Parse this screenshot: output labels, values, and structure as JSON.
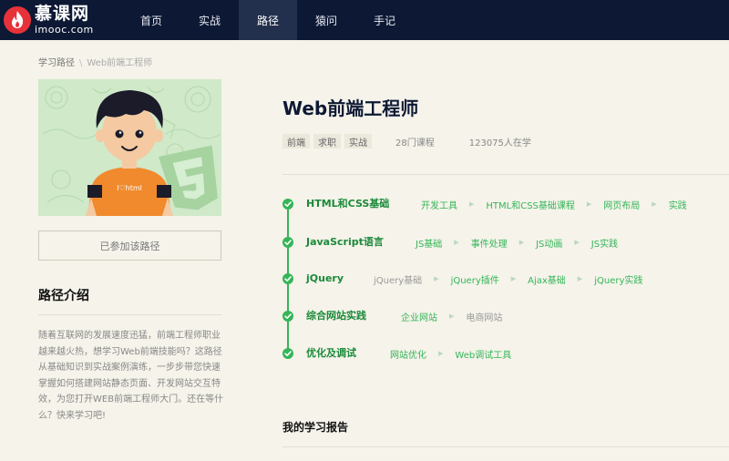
{
  "brand": {
    "name_cn": "慕课网",
    "name_en": "imooc.com"
  },
  "nav": [
    {
      "label": "首页",
      "active": false
    },
    {
      "label": "实战",
      "active": false
    },
    {
      "label": "路径",
      "active": true
    },
    {
      "label": "猿问",
      "active": false
    },
    {
      "label": "手记",
      "active": false
    }
  ],
  "breadcrumb": {
    "parent": "学习路径",
    "separator": "\\",
    "current": "Web前端工程师"
  },
  "banner": {
    "shirt_text": "I♡html"
  },
  "join_button": "已参加该路径",
  "intro": {
    "title": "路径介绍",
    "text": "随着互联网的发展速度迅猛，前端工程师职业越来越火热，想学习Web前端技能吗？这路径从基础知识到实战案例演练，一步步带您快速掌握如何搭建网站静态页面、开发网站交互特效，为您打开WEB前端工程师大门。还在等什么？快来学习吧!"
  },
  "path": {
    "title": "Web前端工程师",
    "tags": [
      "前端",
      "求职",
      "实战"
    ],
    "course_count": "28门课程",
    "learners": "123075人在学"
  },
  "stages": [
    {
      "name": "HTML和CSS基础",
      "courses": [
        {
          "label": "开发工具",
          "done": true
        },
        {
          "label": "HTML和CSS基础课程",
          "done": true
        },
        {
          "label": "网页布局",
          "done": true
        },
        {
          "label": "实践",
          "done": true
        }
      ]
    },
    {
      "name": "JavaScript语言",
      "courses": [
        {
          "label": "JS基础",
          "done": true
        },
        {
          "label": "事件处理",
          "done": true
        },
        {
          "label": "JS动画",
          "done": true
        },
        {
          "label": "JS实践",
          "done": true
        }
      ]
    },
    {
      "name": "jQuery",
      "courses": [
        {
          "label": "jQuery基础",
          "done": false
        },
        {
          "label": "jQuery插件",
          "done": true
        },
        {
          "label": "Ajax基础",
          "done": true
        },
        {
          "label": "jQuery实践",
          "done": true
        }
      ]
    },
    {
      "name": "综合网站实践",
      "courses": [
        {
          "label": "企业网站",
          "done": true
        },
        {
          "label": "电商网站",
          "done": false
        }
      ]
    },
    {
      "name": "优化及调试",
      "courses": [
        {
          "label": "网站优化",
          "done": true
        },
        {
          "label": "Web调试工具",
          "done": true
        }
      ]
    }
  ],
  "report": {
    "title": "我的学习报告"
  },
  "colors": {
    "header_bg": "#0d1934",
    "accent_green": "#35b558",
    "brand_red": "#e8323a",
    "page_bg": "#f5f3ea"
  }
}
